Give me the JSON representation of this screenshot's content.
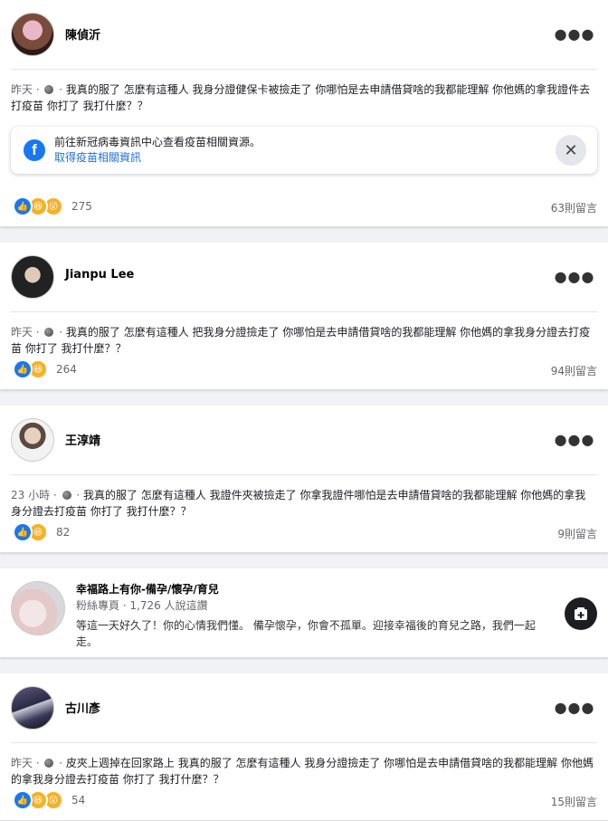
{
  "posts": [
    {
      "author": "陳偵沂",
      "time": "昨天",
      "text": "我真的服了 怎麼有這種人 我身分證健保卡被撿走了 你哪怕是去申請借貸啥的我都能理解 你他媽的拿我證件去打疫苗 你打了 我打什麼？？",
      "reaction_count": "275",
      "comments": "63則留言",
      "reactions": [
        "like",
        "haha",
        "wow"
      ]
    },
    {
      "author": "Jianpu Lee",
      "time": "昨天",
      "text": "我真的服了 怎麼有這種人 把我身分證撿走了 你哪怕是去申請借貸啥的我都能理解 你他媽的拿我身分證去打疫苗 你打了 我打什麼？？",
      "reaction_count": "264",
      "comments": "94則留言",
      "reactions": [
        "like",
        "haha"
      ]
    },
    {
      "author": "王淳靖",
      "time": "23 小時",
      "text": "我真的服了 怎麼有這種人 我證件夾被撿走了 你拿我證件哪怕是去申請借貸啥的我都能理解 你他媽的拿我身分證去打疫苗 你打了 我打什麼？？",
      "reaction_count": "82",
      "comments": "9則留言",
      "reactions": [
        "like",
        "haha"
      ]
    },
    {
      "author": "古川彥",
      "time": "昨天",
      "text": "皮夾上週掉在回家路上 我真的服了 怎麼有這種人 我身分證撿走了 你哪怕是去申請借貸啥的我都能理解 你他媽的拿我身分證去打疫苗 你打了 我打什麼？？",
      "reaction_count": "54",
      "comments": "15則留言",
      "reactions": [
        "like",
        "haha",
        "wow"
      ]
    }
  ],
  "covid_info": {
    "line1": "前往新冠病毒資訊中心查看疫苗相關資源。",
    "line2": "取得疫苗相關資訊"
  },
  "page_card": {
    "name": "幸福路上有你-備孕/懷孕/育兒",
    "meta": "粉絲專頁 · 1,726 人說這讚",
    "desc": "等這一天好久了！你的心情我們懂。 備孕懷孕，你會不孤單。迎接幸福後的育兒之路，我們一起走。"
  },
  "icons": {
    "more": "more-options-icon",
    "globe": "globe-icon",
    "close": "close-icon",
    "add": "add-icon"
  },
  "colors": {
    "like": "#1877f2",
    "haha": "#f7b125",
    "link": "#216fdb"
  }
}
